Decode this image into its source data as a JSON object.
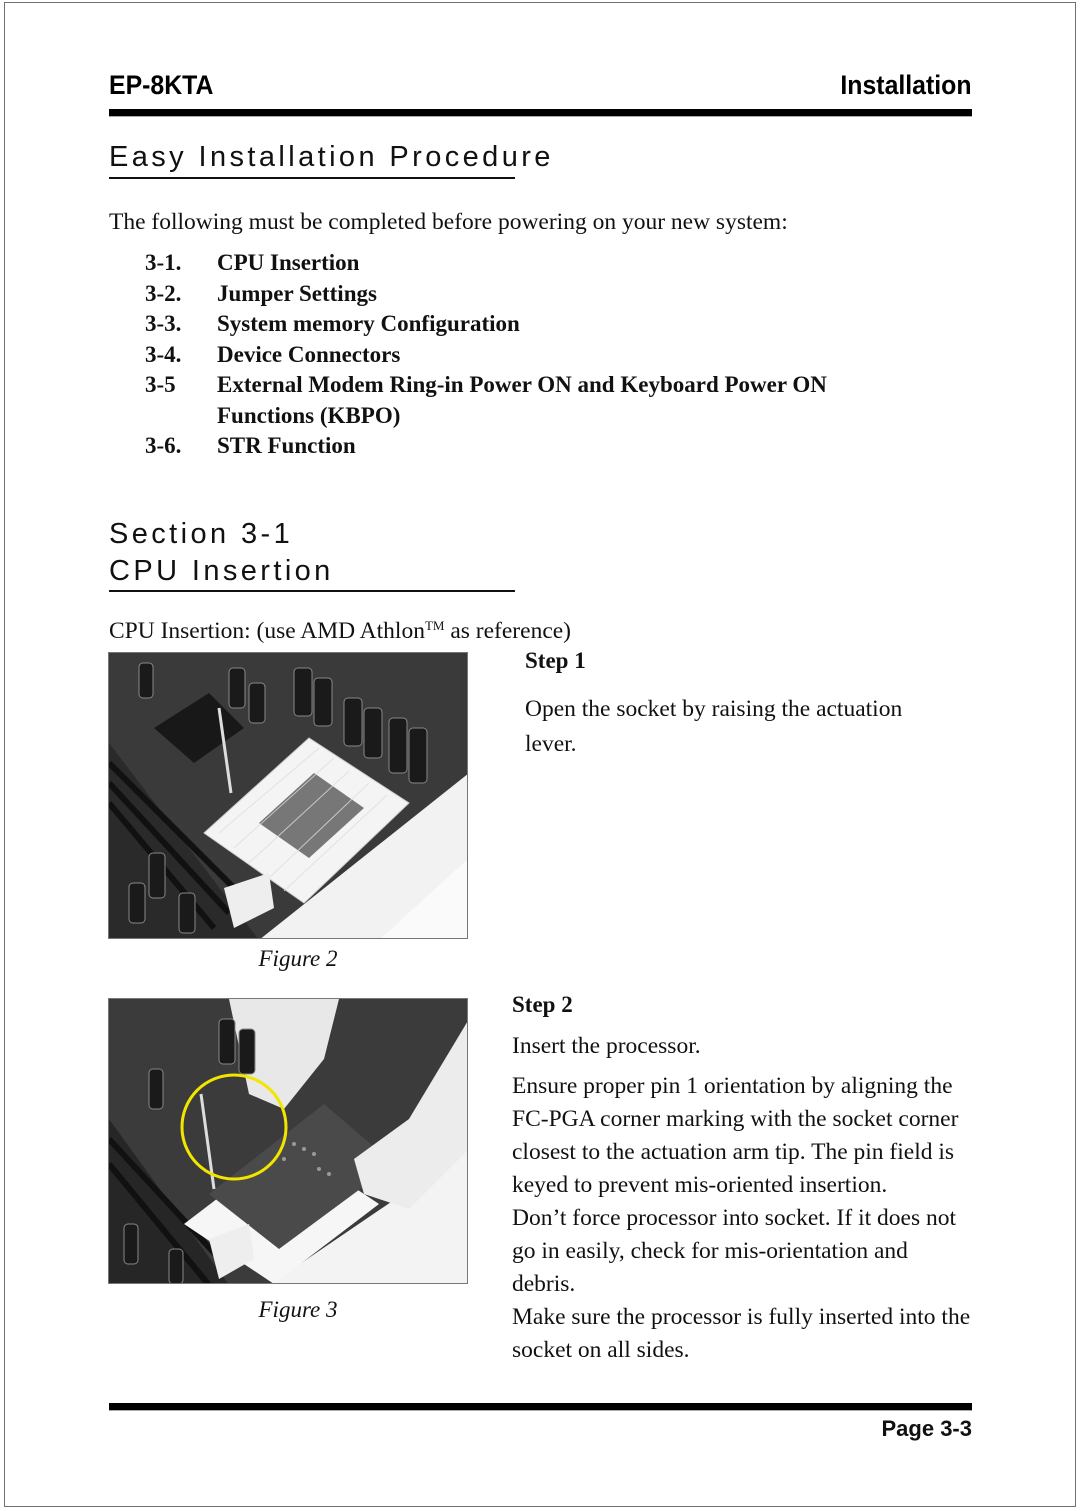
{
  "header": {
    "model": "EP-8KTA",
    "chapter": "Installation"
  },
  "easy_install": {
    "title": "Easy Installation Procedure",
    "intro": "The following must be completed before powering on your new system:",
    "items": [
      {
        "num": "3-1.",
        "label": "CPU Insertion"
      },
      {
        "num": "3-2.",
        "label": "Jumper Settings"
      },
      {
        "num": "3-3.",
        "label": "System memory Configuration"
      },
      {
        "num": "3-4.",
        "label": "Device Connectors"
      },
      {
        "num": "3-5",
        "label": "External Modem Ring-in Power ON and Keyboard Power ON Functions (KBPO)"
      },
      {
        "num": "3-6.",
        "label": "STR Function"
      }
    ]
  },
  "section": {
    "line1": "Section 3-1",
    "line2": "CPU Insertion",
    "intro_prefix": "CPU Insertion: (use AMD Athlon",
    "intro_tm": "TM",
    "intro_suffix": " as reference)"
  },
  "step1": {
    "title": "Step 1",
    "text": "Open the socket by raising the actuation lever.",
    "figure_caption": "Figure 2",
    "figure_alt": "Motherboard CPU socket with actuation lever raised"
  },
  "step2": {
    "title": "Step 2",
    "paragraphs": [
      "Insert the processor.",
      "Ensure proper pin 1 orientation by aligning the FC-PGA corner marking with the socket corner closest to the actuation arm tip. The pin field is keyed to prevent mis-oriented insertion.",
      "Don’t force processor into socket. If it does not go in easily, check for mis-orientation and debris.",
      "Make sure the processor is fully inserted into the socket on all sides."
    ],
    "figure_caption": "Figure 3",
    "figure_alt": "Processor being inserted into socket, pin 1 corner circled",
    "highlight_color": "#f2e600"
  },
  "footer": {
    "page": "Page 3-3"
  }
}
